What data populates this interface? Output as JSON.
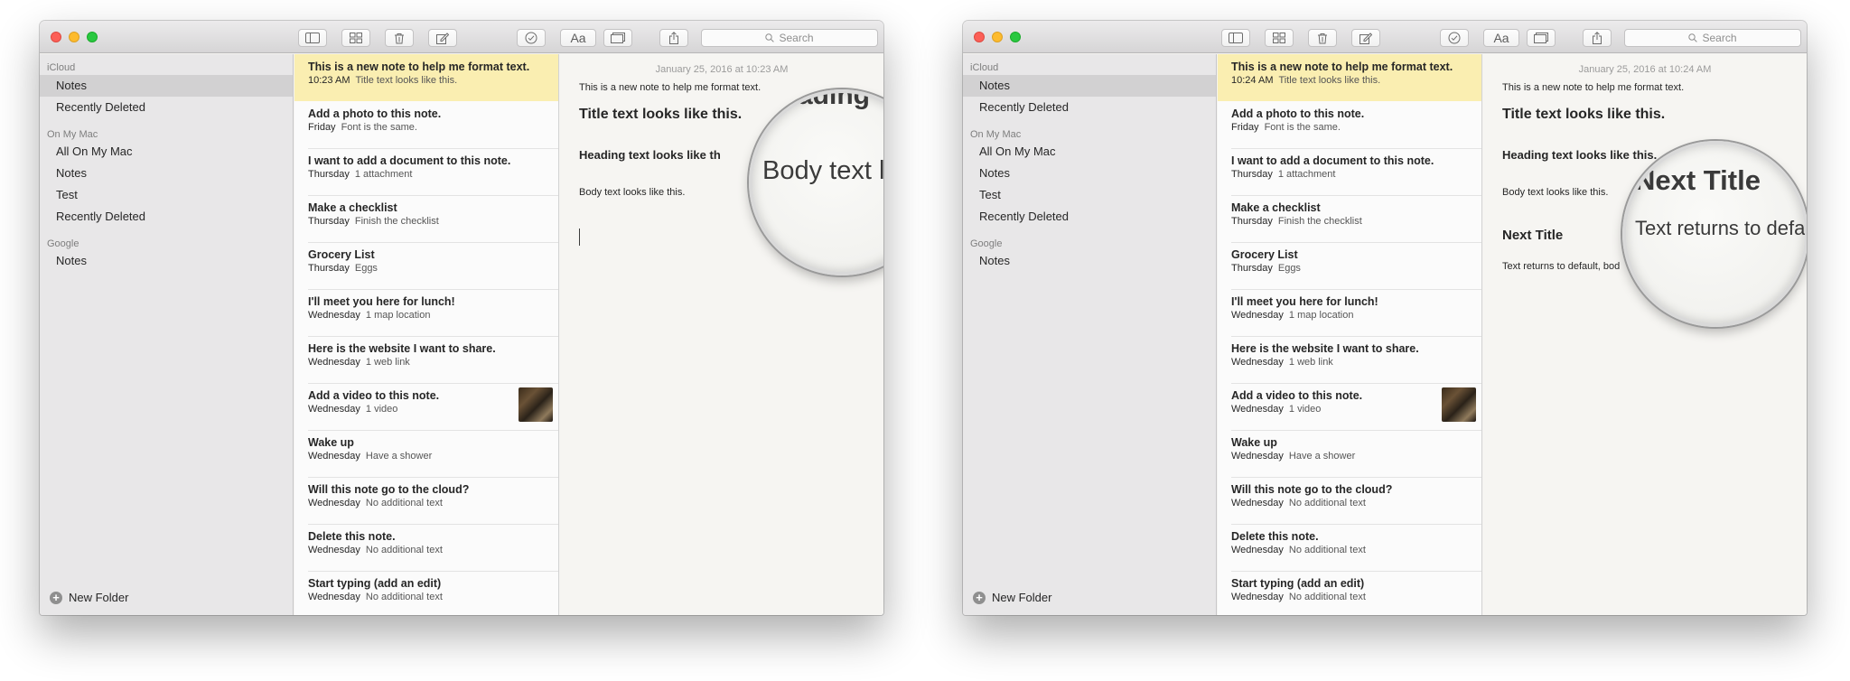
{
  "toolbar": {
    "icons": [
      "sidebar-toggle-icon",
      "grid-icon",
      "trash-icon",
      "compose-icon",
      "checkmark-icon",
      "font-aa-icon",
      "attachment-browser-icon",
      "share-icon",
      "search-icon"
    ],
    "format_label": "Aa",
    "search_placeholder": "Search"
  },
  "sidebar": {
    "icloud_header": "iCloud",
    "icloud_items": [
      "Notes",
      "Recently Deleted"
    ],
    "onmymac_header": "On My Mac",
    "onmymac_items": [
      "All On My Mac",
      "Notes",
      "Test",
      "Recently Deleted"
    ],
    "google_header": "Google",
    "google_items": [
      "Notes"
    ],
    "new_folder": "New Folder",
    "selected": "Notes"
  },
  "notes_list": [
    {
      "title": "This is a new note to help me format text.",
      "date": "10:23 AM",
      "preview": "Title text looks like this."
    },
    {
      "title": "Add a photo to this note.",
      "date": "Friday",
      "preview": "Font is the same."
    },
    {
      "title": "I want to add a document to this note.",
      "date": "Thursday",
      "preview": "1 attachment"
    },
    {
      "title": "Make a checklist",
      "date": "Thursday",
      "preview": "Finish the checklist"
    },
    {
      "title": "Grocery List",
      "date": "Thursday",
      "preview": "Eggs"
    },
    {
      "title": "I'll meet you here for lunch!",
      "date": "Wednesday",
      "preview": "1 map location"
    },
    {
      "title": "Here is the website I want to share.",
      "date": "Wednesday",
      "preview": "1 web link"
    },
    {
      "title": "Add a video to this note.",
      "date": "Wednesday",
      "preview": "1 video"
    },
    {
      "title": "Wake up",
      "date": "Wednesday",
      "preview": "Have a shower"
    },
    {
      "title": "Will this note go to the cloud?",
      "date": "Wednesday",
      "preview": "No additional text"
    },
    {
      "title": "Delete this note.",
      "date": "Wednesday",
      "preview": "No additional text"
    },
    {
      "title": "Start typing (add an edit)",
      "date": "Wednesday",
      "preview": "No additional text"
    }
  ],
  "selected_note_time_right": "10:24 AM",
  "left_editor": {
    "date": "January 25, 2016 at 10:23 AM",
    "intro": "This is a new note to help me format text.",
    "title": "Title text looks like this.",
    "heading": "Heading text looks like th",
    "body": "Body text looks like this.",
    "mag_top": "ading",
    "mag_text": "Body text looks"
  },
  "right_editor": {
    "date": "January 25, 2016 at 10:24 AM",
    "intro": "This is a new note to help me format text.",
    "title": "Title text looks like this.",
    "heading": "Heading text looks like this.",
    "body": "Body text looks like this.",
    "next_title": "Next Title",
    "returns_text": "Text returns to default, bod",
    "mag_title": "Next Title",
    "mag_text": "Text returns to defau"
  }
}
